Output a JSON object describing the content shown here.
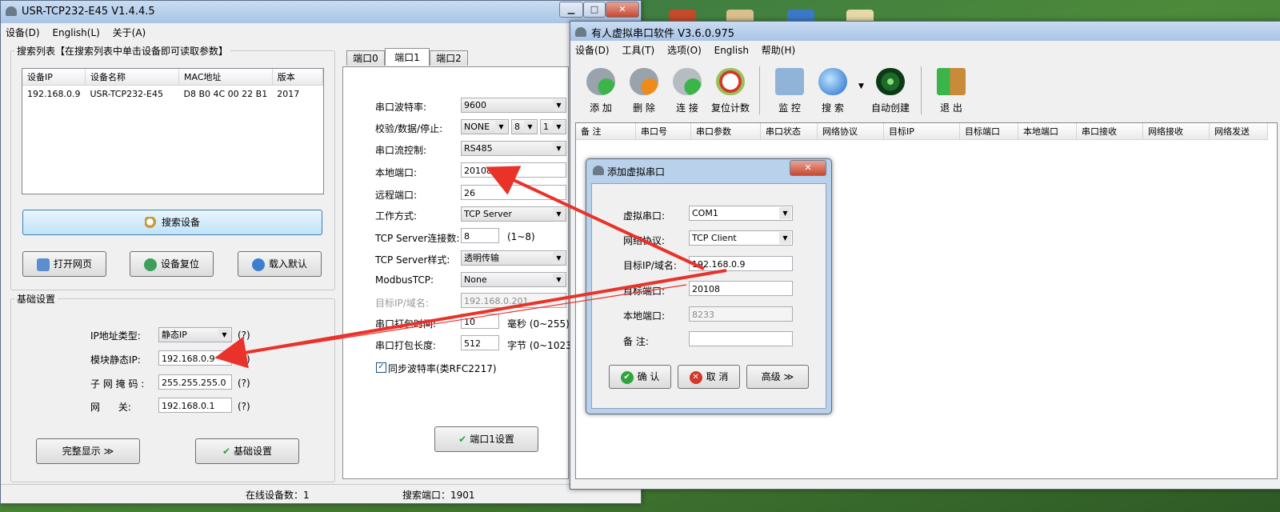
{
  "win1": {
    "title": "USR-TCP232-E45 V1.4.4.5",
    "menu": [
      "设备(D)",
      "English(L)",
      "关于(A)"
    ],
    "search_group": "搜索列表【在搜索列表中单击设备即可读取参数】",
    "columns": [
      "设备IP",
      "设备名称",
      "MAC地址",
      "版本"
    ],
    "rows": [
      [
        "192.168.0.9",
        "USR-TCP232-E45",
        "D8 B0 4C 00 22 B1",
        "2017"
      ]
    ],
    "search_button": "搜索设备",
    "open_web": "打开网页",
    "device_reset": "设备复位",
    "load_default": "载入默认",
    "basic_group": "基础设置",
    "ip_type_label": "IP地址类型:",
    "ip_type_value": "静态IP",
    "static_ip_label": "模块静态IP:",
    "static_ip_value": "192.168.0.9",
    "subnet_label": "子 网 掩 码 :",
    "subnet_value": "255.255.255.0",
    "gateway_label": "网      关:",
    "gateway_value": "192.168.0.1",
    "q": "(?)",
    "full_show": "完整显示 ≫",
    "basic_set": "基础设置",
    "tabs": [
      "端口0",
      "端口1",
      "端口2"
    ],
    "baud_label": "串口波特率:",
    "baud_value": "9600",
    "parity_label": "校验/数据/停止:",
    "parity_value": "NONE",
    "data_value": "8",
    "stop_value": "1",
    "flow_label": "串口流控制:",
    "flow_value": "RS485",
    "local_port_label": "本地端口:",
    "local_port_value": "20108",
    "remote_port_label": "远程端口:",
    "remote_port_value": "26",
    "mode_label": "工作方式:",
    "mode_value": "TCP Server",
    "conn_label": "TCP Server连接数:",
    "conn_value": "8",
    "conn_hint": "(1~8)",
    "style_label": "TCP Server样式:",
    "style_value": "透明传输",
    "modbus_label": "ModbusTCP:",
    "modbus_value": "None",
    "target_label": "目标IP/域名:",
    "target_value": "192.168.0.201",
    "pack_time_label": "串口打包时间:",
    "pack_time_value": "10",
    "pack_time_hint": "毫秒 (0~255)",
    "pack_len_label": "串口打包长度:",
    "pack_len_value": "512",
    "pack_len_hint": "字节 (0~1023)",
    "sync_label": "同步波特率(类RFC2217)",
    "port_set": "端口1设置",
    "status_online": "在线设备数：1",
    "status_port": "搜索端口：1901"
  },
  "win2": {
    "title": "有人虚拟串口软件 V3.6.0.975",
    "menu": [
      "设备(D)",
      "工具(T)",
      "选项(O)",
      "English",
      "帮助(H)"
    ],
    "tools": [
      "添 加",
      "删 除",
      "连 接",
      "复位计数",
      "监 控",
      "搜 索",
      "自动创建",
      "退 出"
    ],
    "columns": [
      "备 注",
      "串口号",
      "串口参数",
      "串口状态",
      "网络协议",
      "目标IP",
      "目标端口",
      "本地端口",
      "串口接收",
      "网络接收",
      "网络发送"
    ]
  },
  "dialog": {
    "title": "添加虚拟串口",
    "vport_label": "虚拟串口:",
    "vport_value": "COM1",
    "proto_label": "网络协议:",
    "proto_value": "TCP Client",
    "target_label": "目标IP/域名:",
    "target_value": "192.168.0.9",
    "tport_label": "目标端口:",
    "tport_value": "20108",
    "lport_label": "本地端口:",
    "lport_value": "8233",
    "note_label": "备 注:",
    "note_value": "",
    "ok": "确 认",
    "cancel": "取 消",
    "advanced": "高级 ≫"
  },
  "colors": {
    "arrow": "#e8322a",
    "title_bar": "#b9d1ea",
    "window_bg": "#f0f0f0"
  }
}
